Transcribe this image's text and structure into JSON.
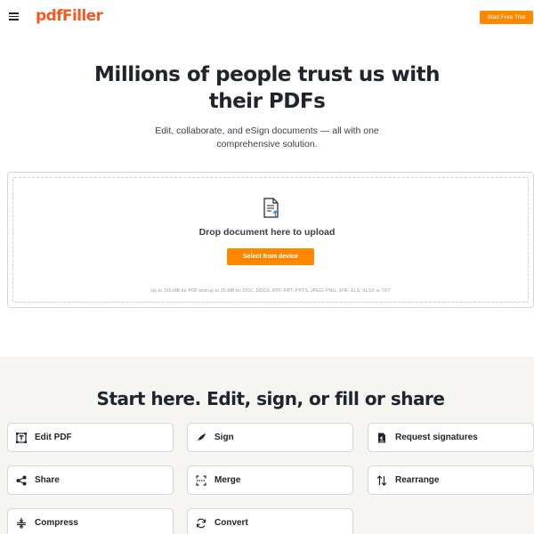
{
  "header": {
    "logo_text": "pdfFiller",
    "trial_label": "Start Free Trial",
    "logo_color": "#f15a24",
    "accent_color": "#ff8800"
  },
  "hero": {
    "title": "Millions of people trust us with their PDFs",
    "subtitle": "Edit, collaborate, and eSign documents — all with one comprehensive solution."
  },
  "upload": {
    "drop_text": "Drop document here to upload",
    "select_label": "Select from device",
    "limits_text": "Up to 100 MB for PDF and up to 25 MB for DOC, DOCX, RTF, PPT, PPTX, JPEG, PNG, JFIF, XLS, XLSX or TXT"
  },
  "start": {
    "title": "Start here. Edit, sign, or fill or share",
    "tools": [
      {
        "label": "Edit PDF",
        "icon": "edit-pdf-icon"
      },
      {
        "label": "Sign",
        "icon": "pen-nib-icon"
      },
      {
        "label": "Request signatures",
        "icon": "signature-doc-icon"
      },
      {
        "label": "Share",
        "icon": "share-icon"
      },
      {
        "label": "Merge",
        "icon": "merge-icon"
      },
      {
        "label": "Rearrange",
        "icon": "rearrange-icon"
      },
      {
        "label": "Compress",
        "icon": "compress-icon"
      },
      {
        "label": "Convert",
        "icon": "convert-icon"
      }
    ]
  }
}
